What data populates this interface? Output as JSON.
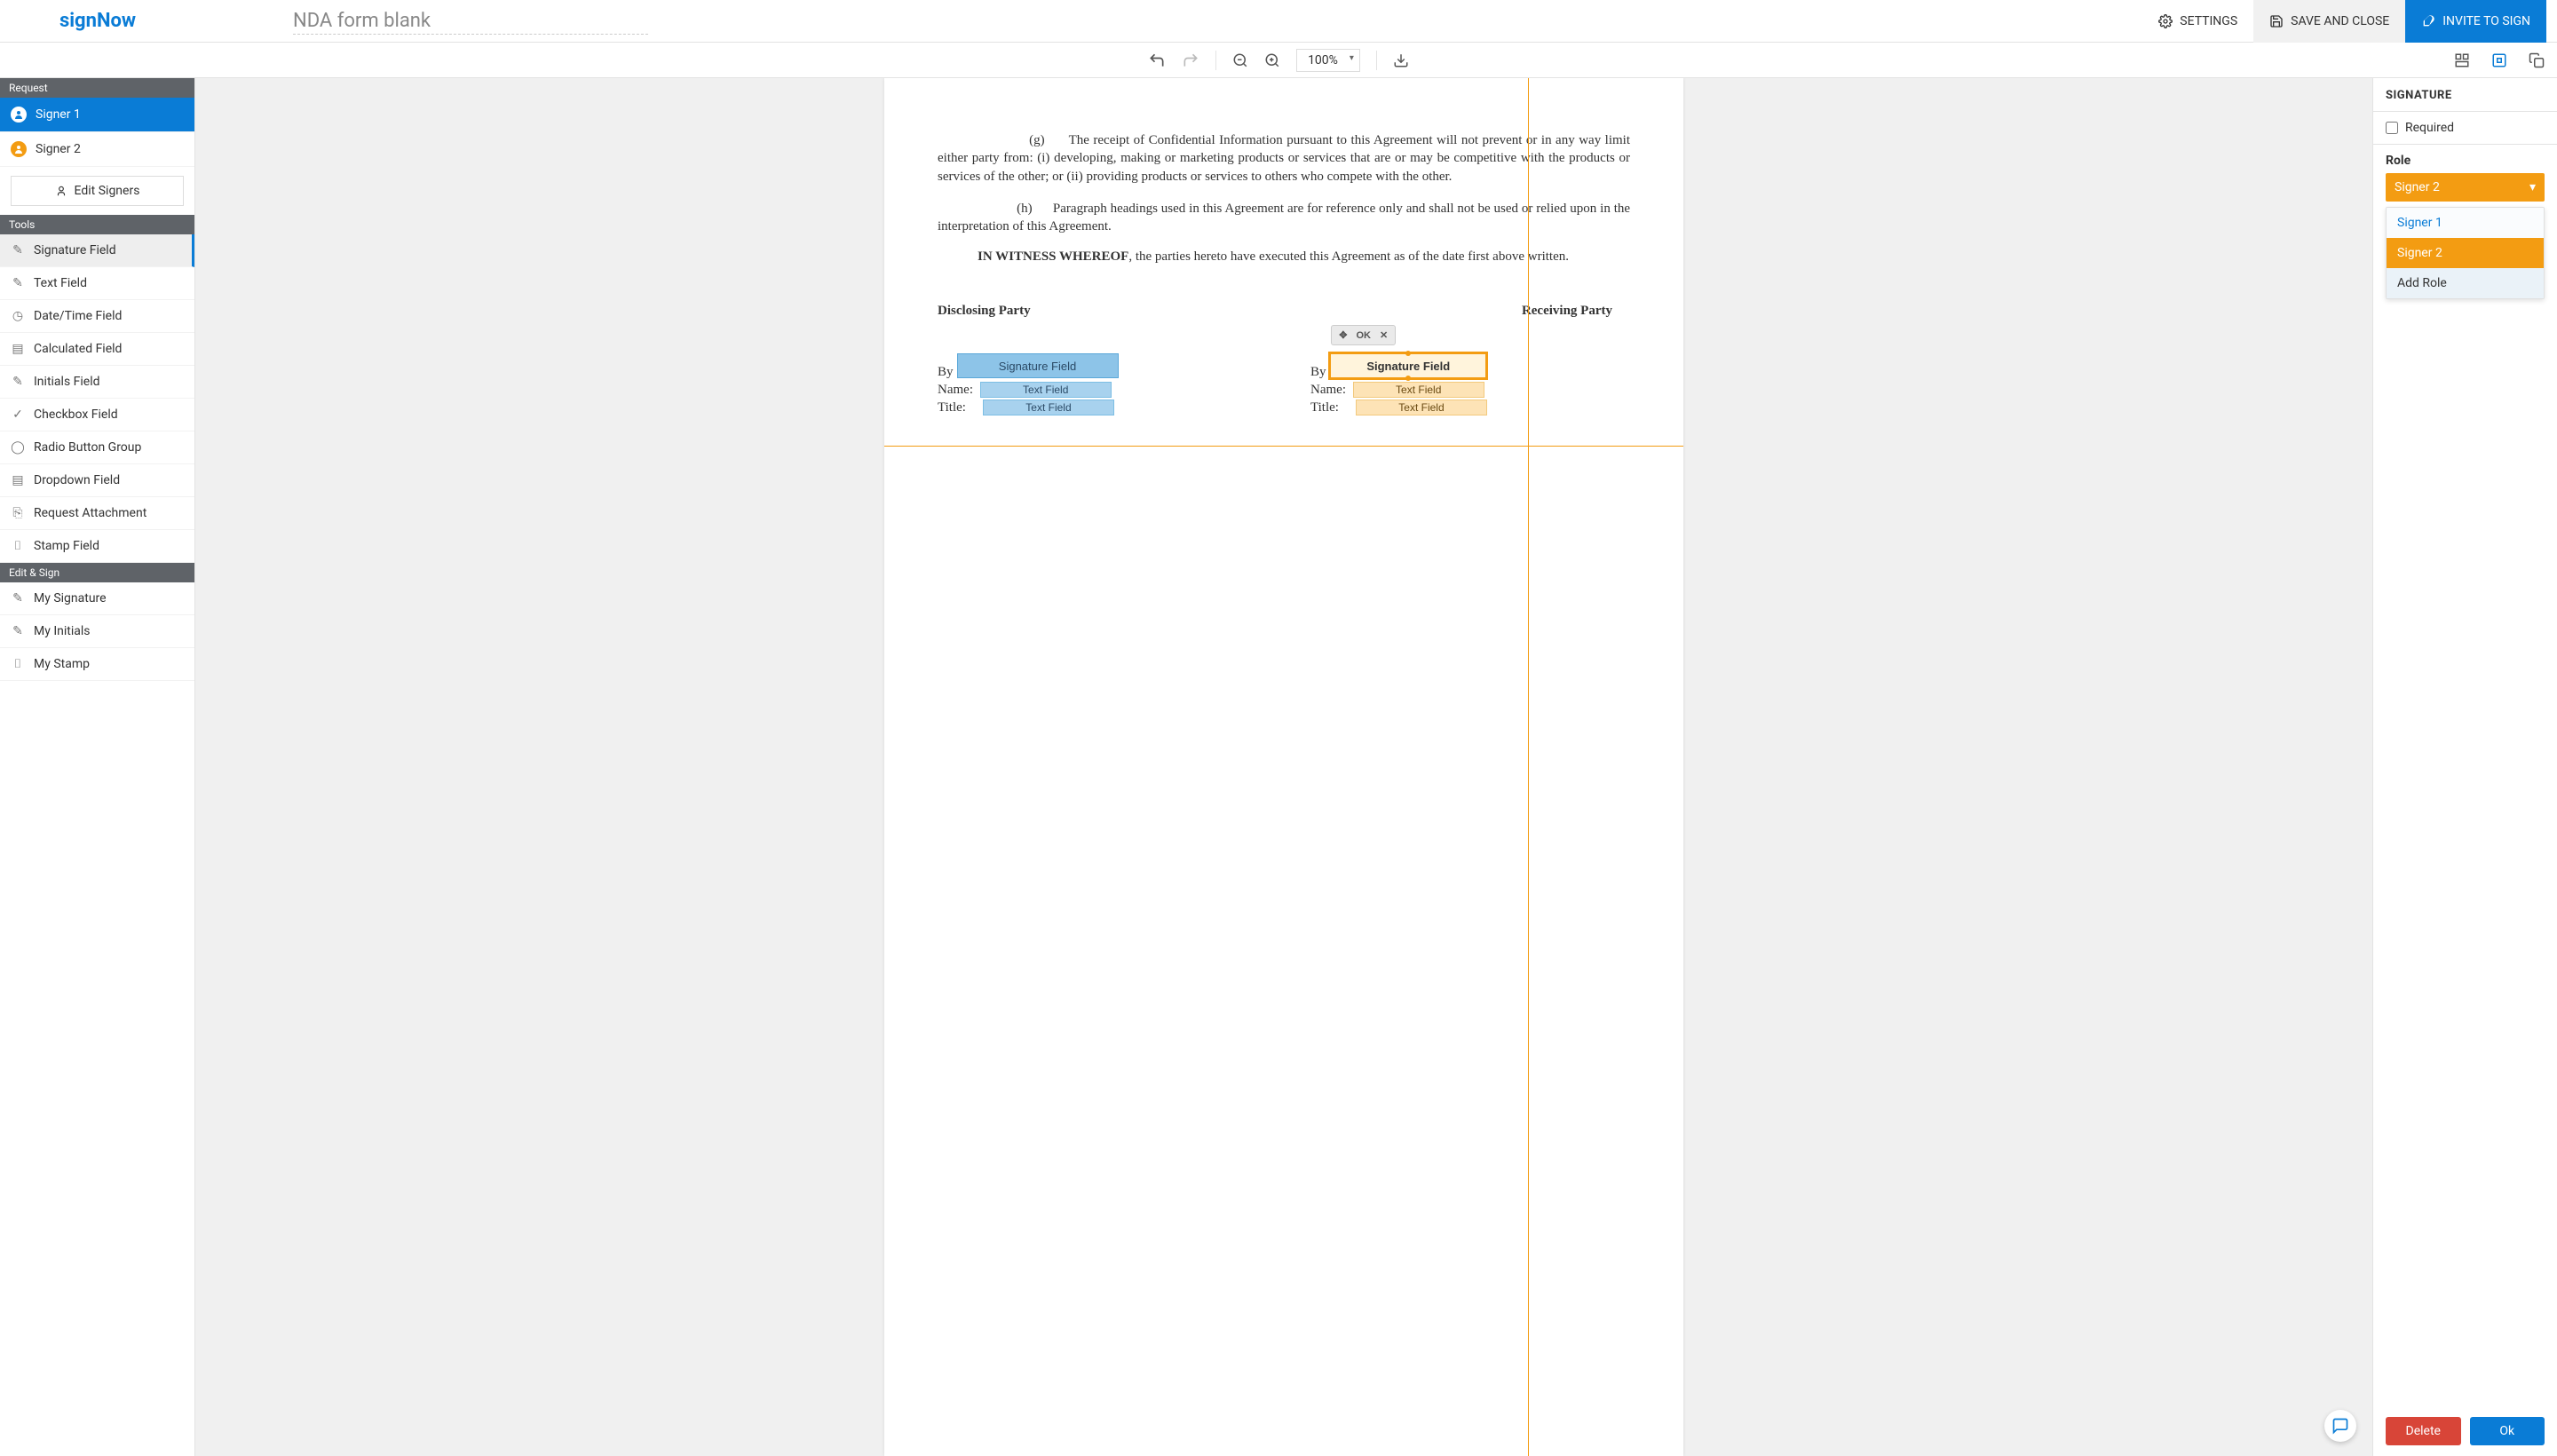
{
  "header": {
    "logo": "signNow",
    "doc_title": "NDA form blank",
    "settings": "SETTINGS",
    "save_close": "SAVE AND CLOSE",
    "invite": "INVITE TO SIGN"
  },
  "toolbar": {
    "zoom": "100%"
  },
  "sidebar": {
    "request_hdr": "Request",
    "signer1": "Signer 1",
    "signer2": "Signer 2",
    "edit_signers": "Edit Signers",
    "tools_hdr": "Tools",
    "tools": [
      "Signature Field",
      "Text Field",
      "Date/Time Field",
      "Calculated Field",
      "Initials Field",
      "Checkbox Field",
      "Radio Button Group",
      "Dropdown Field",
      "Request Attachment",
      "Stamp Field"
    ],
    "edit_sign_hdr": "Edit & Sign",
    "edit_sign": [
      "My Signature",
      "My Initials",
      "My Stamp"
    ]
  },
  "doc": {
    "g_clause": "(g)",
    "g_text": "The receipt of Confidential Information pursuant to this Agreement will not prevent or in any way limit either party from: (i) developing, making or marketing products or services that are or may be competitive with the products or services of the other; or (ii) providing products or services to others who compete with the other.",
    "h_clause": "(h)",
    "h_text": "Paragraph headings used in this Agreement are for reference only and shall not be used or relied upon in the interpretation of this Agreement.",
    "witness_bold": "IN WITNESS WHEREOF",
    "witness_rest": ", the parties hereto have executed this Agreement as of the date first above written.",
    "disclosing": "Disclosing Party",
    "receiving": "Receiving Party",
    "by": "By",
    "name": "Name:",
    "title": "Title:"
  },
  "fields": {
    "sig_label": "Signature Field",
    "txt_label": "Text Field",
    "popover_ok": "OK"
  },
  "rightpanel": {
    "title": "SIGNATURE",
    "required": "Required",
    "role": "Role",
    "selected_role": "Signer 2",
    "options": {
      "s1": "Signer 1",
      "s2": "Signer 2",
      "add": "Add Role"
    },
    "delete": "Delete",
    "ok": "Ok"
  }
}
